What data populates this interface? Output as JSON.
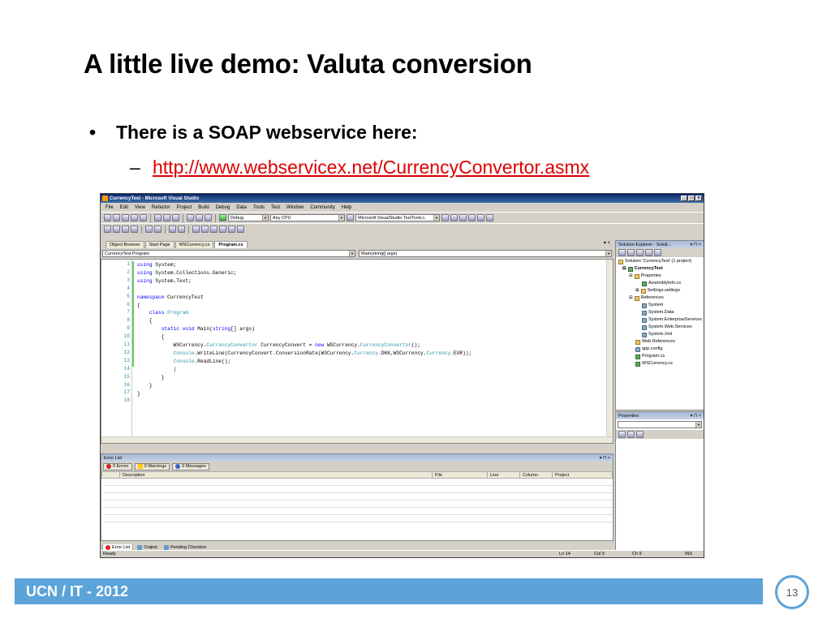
{
  "slide": {
    "title": "A little live demo: Valuta conversion",
    "bullet": "There is a SOAP webservice here:",
    "bullet_marker": "•",
    "sub_marker": "–",
    "link": "http://www.webservicex.net/CurrencyConvertor.asmx",
    "footer": "UCN / IT - 2012",
    "page_number": "13",
    "accent_color": "#5ba3d9",
    "link_color": "#dd0000"
  },
  "vs": {
    "window_title": "CurrencyTest - Microsoft Visual Studio",
    "window_buttons": [
      "_",
      "□",
      "×"
    ],
    "menu": [
      "File",
      "Edit",
      "View",
      "Refactor",
      "Project",
      "Build",
      "Debug",
      "Data",
      "Tools",
      "Test",
      "Window",
      "Community",
      "Help"
    ],
    "config_combo": "Debug",
    "platform_combo": "Any CPU",
    "testtools_combo": "Microsoft.VisualStudio.TestTools.L",
    "tabs": [
      "Object Browser",
      "Start Page",
      "WSCurrency.cs",
      "Program.cs"
    ],
    "tab_controls": "▾ ×",
    "nav_left": "CurrencyTest.Program",
    "nav_right": "Main(string[] args)",
    "line_numbers": [
      "1",
      "2",
      "3",
      "4",
      "5",
      "6",
      "7",
      "8",
      "9",
      "10",
      "11",
      "12",
      "13",
      "14",
      "15",
      "16",
      "17",
      "18"
    ],
    "error_list": {
      "title": "Error List",
      "controls": "▾ ⊓ ×",
      "errors": "0 Errors",
      "warnings": "0 Warnings",
      "messages": "0 Messages",
      "columns": [
        "",
        "Description",
        "File",
        "Line",
        "Column",
        "Project"
      ]
    },
    "bottom_tabs": [
      "Error List",
      "Output",
      "Pending Checkins"
    ],
    "status": {
      "ready": "Ready",
      "ln": "Ln 14",
      "col": "Col 9",
      "ch": "Ch 9",
      "ins": "INS"
    },
    "solution_explorer": {
      "title": "Solution Explorer - Soluti...",
      "controls": "▾ ⊓ ×",
      "nodes": [
        "Solution 'CurrencyTest' (1 project)",
        "CurrencyTest",
        "Properties",
        "AssemblyInfo.cs",
        "Settings.settings",
        "References",
        "System",
        "System.Data",
        "System.EnterpriseServices",
        "System.Web.Services",
        "System.Xml",
        "Web References",
        "app.config",
        "Program.cs",
        "WSCurrency.cs"
      ]
    },
    "properties": {
      "title": "Properties",
      "controls": "▾ ⊓ ×"
    }
  }
}
